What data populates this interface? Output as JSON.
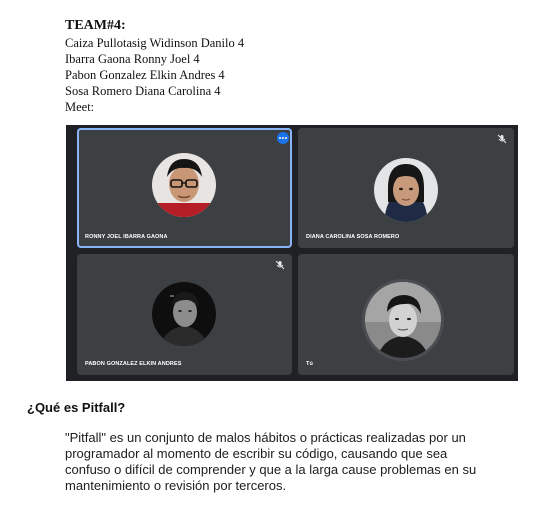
{
  "team": {
    "title": "TEAM#4:",
    "members": [
      "Caiza Pullotasig Widinson Danilo 4",
      "Ibarra Gaona Ronny Joel 4",
      "Pabon Gonzalez Elkin Andres 4",
      "Sosa Romero Diana Carolina 4"
    ],
    "meet_label": "Meet:"
  },
  "meet": {
    "participants": [
      {
        "name": "RONNY JOEL IBARRA GAONA"
      },
      {
        "name": "DIANA CAROLINA SOSA ROMERO"
      },
      {
        "name": "PABON GONZALEZ ELKIN ANDRES"
      },
      {
        "name": "Tú"
      }
    ]
  },
  "section": {
    "heading": "¿Qué es Pitfall?",
    "body": "\"Pitfall\" es un conjunto de malos hábitos o prácticas realizadas por un programador al momento de escribir su código, causando que sea confuso o difícil de comprender y que a la larga cause problemas en su mantenimiento o revisión por terceros."
  },
  "colors": {
    "meet_background": "#202124",
    "tile_background": "#3c4043",
    "active_speaker_border": "#8ab4f8",
    "more_button": "#1a73e8"
  }
}
